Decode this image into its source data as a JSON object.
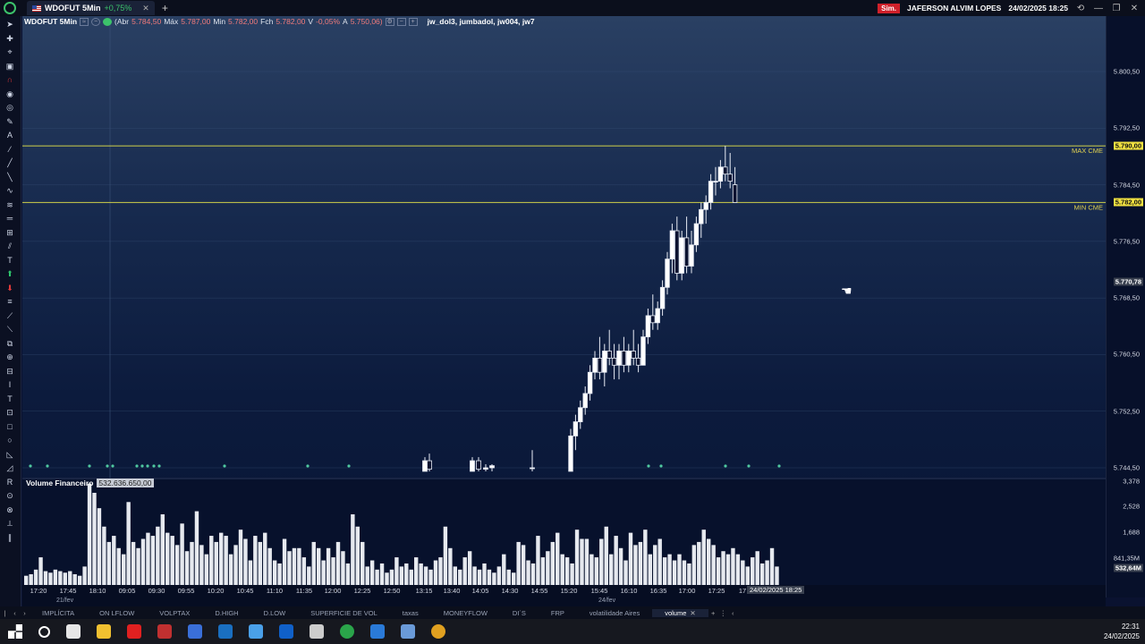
{
  "app": {
    "tab_symbol": "WDOFUT 5Min",
    "tab_change": "+0,75%",
    "sim_badge": "Sim.",
    "user": "JAFERSON ALVIM LOPES",
    "datetime": "24/02/2025 18:25"
  },
  "header": {
    "symbol": "WDOFUT 5Min",
    "open_label": "(Abr",
    "open_value": "5.784,50",
    "max_label": "Máx",
    "max_value": "5.787,00",
    "min_label": "Min",
    "min_value": "5.782,00",
    "close_label": "Fch",
    "close_value": "5.782,00",
    "var_label": "V",
    "var_value": "-0,05%",
    "a_label": "A",
    "a_value": "5.750,06)",
    "indicators": "jw_dol3, jumbadol, jw004, jw7"
  },
  "levels": {
    "max_cme_label": "MAX CME",
    "max_cme_value": "5.790,00",
    "min_cme_label": "MIN CME",
    "min_cme_value": "5.782,00",
    "crosshair_value": "5.770,78"
  },
  "price_axis": {
    "labels": [
      "5.800,50",
      "5.792,50",
      "5.784,50",
      "5.776,50",
      "5.768,50",
      "5.760,50",
      "5.752,50",
      "5.744,50"
    ],
    "label_values": [
      5800.5,
      5792.5,
      5784.5,
      5776.5,
      5768.5,
      5760.5,
      5752.5,
      5744.5
    ]
  },
  "volume": {
    "label": "Volume Financeiro",
    "current": "532.636.650,00",
    "axis_labels": [
      "3,378",
      "2,528",
      "1,688",
      "841,35M"
    ],
    "last_badge": "532,64M"
  },
  "time_axis": {
    "labels": [
      "17:20",
      "17:45",
      "18:10",
      "09:05",
      "09:30",
      "09:55",
      "10:20",
      "10:45",
      "11:10",
      "11:35",
      "12:00",
      "12:25",
      "12:50",
      "13:15",
      "13:40",
      "14:05",
      "14:30",
      "14:55",
      "15:20",
      "15:45",
      "16:10",
      "16:35",
      "17:00",
      "17:25",
      "17"
    ],
    "dates": [
      "21/fev",
      "24/fev"
    ],
    "current": "24/02/2025 18:25"
  },
  "chart_data": {
    "type": "candlestick",
    "ylim": [
      5742,
      5803
    ],
    "candles": [
      [
        5744,
        5750,
        5744,
        5749
      ],
      [
        5749,
        5752,
        5747,
        5751
      ],
      [
        5751,
        5754,
        5750,
        5753
      ],
      [
        5753,
        5756,
        5752,
        5755
      ],
      [
        5755,
        5759,
        5754,
        5758
      ],
      [
        5758,
        5761,
        5757,
        5760
      ],
      [
        5760,
        5763,
        5757,
        5758
      ],
      [
        5758,
        5762,
        5756,
        5761
      ],
      [
        5761,
        5764,
        5759,
        5760
      ],
      [
        5760,
        5762,
        5757,
        5759
      ],
      [
        5759,
        5762,
        5757,
        5761
      ],
      [
        5761,
        5763,
        5758,
        5759
      ],
      [
        5759,
        5762,
        5758,
        5761
      ],
      [
        5761,
        5764,
        5759,
        5760
      ],
      [
        5760,
        5762,
        5758,
        5759
      ],
      [
        5759,
        5764,
        5759,
        5763
      ],
      [
        5763,
        5767,
        5762,
        5766
      ],
      [
        5766,
        5769,
        5764,
        5765
      ],
      [
        5765,
        5768,
        5764,
        5767
      ],
      [
        5767,
        5771,
        5766,
        5770
      ],
      [
        5770,
        5775,
        5769,
        5774
      ],
      [
        5774,
        5779,
        5772,
        5778
      ],
      [
        5778,
        5780,
        5771,
        5772
      ],
      [
        5772,
        5778,
        5771,
        5777
      ],
      [
        5777,
        5780,
        5772,
        5773
      ],
      [
        5773,
        5778,
        5772,
        5776
      ],
      [
        5776,
        5780,
        5775,
        5779
      ],
      [
        5779,
        5782,
        5777,
        5781
      ],
      [
        5781,
        5783,
        5779,
        5782
      ],
      [
        5782,
        5786,
        5781,
        5785
      ],
      [
        5785,
        5787,
        5783,
        5785
      ],
      [
        5785,
        5788,
        5784,
        5787
      ],
      [
        5787,
        5790,
        5785,
        5786
      ],
      [
        5786,
        5789,
        5784,
        5785
      ],
      [
        5784.5,
        5787,
        5782,
        5782
      ]
    ],
    "early_candles": [
      [
        5744,
        5746,
        5744,
        5745.5
      ],
      [
        5745.5,
        5746.5,
        5744,
        5744.3
      ],
      [
        5744,
        5746,
        5744,
        5745.5
      ],
      [
        5745.5,
        5746,
        5744,
        5744.3
      ],
      [
        5744.3,
        5745,
        5744,
        5744.5
      ],
      [
        5744.5,
        5745,
        5744,
        5744.8
      ],
      [
        5744.5,
        5747,
        5744,
        5744.5
      ]
    ],
    "volumes": [
      0.3,
      0.35,
      0.5,
      0.9,
      0.45,
      0.4,
      0.5,
      0.45,
      0.4,
      0.45,
      0.35,
      0.3,
      0.6,
      3.3,
      3.0,
      2.5,
      1.9,
      1.4,
      1.6,
      1.2,
      1.0,
      2.7,
      1.4,
      1.2,
      1.5,
      1.7,
      1.6,
      1.9,
      2.3,
      1.7,
      1.6,
      1.3,
      2.0,
      1.1,
      1.4,
      2.4,
      1.3,
      1.0,
      1.6,
      1.4,
      1.7,
      1.6,
      1.0,
      1.3,
      1.8,
      1.5,
      0.8,
      1.6,
      1.4,
      1.7,
      1.2,
      0.8,
      0.7,
      1.5,
      1.1,
      1.2,
      1.2,
      0.9,
      0.6,
      1.4,
      1.2,
      0.8,
      1.2,
      0.9,
      1.4,
      1.1,
      0.7,
      2.3,
      1.9,
      1.4,
      0.6,
      0.8,
      0.5,
      0.7,
      0.4,
      0.5,
      0.9,
      0.6,
      0.7,
      0.5,
      0.9,
      0.7,
      0.6,
      0.5,
      0.8,
      0.9,
      1.9,
      1.2,
      0.6,
      0.5,
      0.9,
      1.1,
      0.6,
      0.5,
      0.7,
      0.5,
      0.4,
      0.6,
      1.0,
      0.5,
      0.4,
      1.4,
      1.3,
      0.8,
      0.7,
      1.6,
      0.9,
      1.1,
      1.4,
      1.7,
      1.0,
      0.9,
      0.7,
      1.8,
      1.5,
      1.5,
      1.0,
      0.9,
      1.5,
      1.9,
      1.0,
      1.6,
      1.2,
      0.8,
      1.7,
      1.3,
      1.4,
      1.8,
      1.0,
      1.3,
      1.5,
      0.9,
      1.0,
      0.8,
      1.0,
      0.8,
      0.7,
      1.3,
      1.4,
      1.8,
      1.5,
      1.3,
      0.9,
      1.1,
      1.0,
      1.2,
      1.0,
      0.8,
      0.6,
      0.9,
      1.1,
      0.7,
      0.8,
      1.2,
      0.6
    ],
    "vlim": [
      0,
      3.378
    ]
  },
  "sheet_tabs": [
    "IMPLÍCITA",
    "ON LFLOW",
    "VOLPTAX",
    "D.HIGH",
    "D.LOW",
    "SUPERFICIE DE VOL",
    "taxas",
    "MONEYFLOW",
    "DI´S",
    "FRP",
    "volatilidade Aires",
    "volume"
  ],
  "active_tab": "volume",
  "taskbar": {
    "time": "22:31",
    "date": "24/02/2025",
    "icon_colors": [
      "#ffffff",
      "#ffffff",
      "#e6e6e6",
      "#f0c030",
      "#e02020",
      "#c03030",
      "#3a6fd8",
      "#1a6fc0",
      "#4aa0e8",
      "#1060c8",
      "#cccccc",
      "#2aa44a",
      "#2a7ad8",
      "#6a9ad8",
      "#e0a020"
    ]
  }
}
